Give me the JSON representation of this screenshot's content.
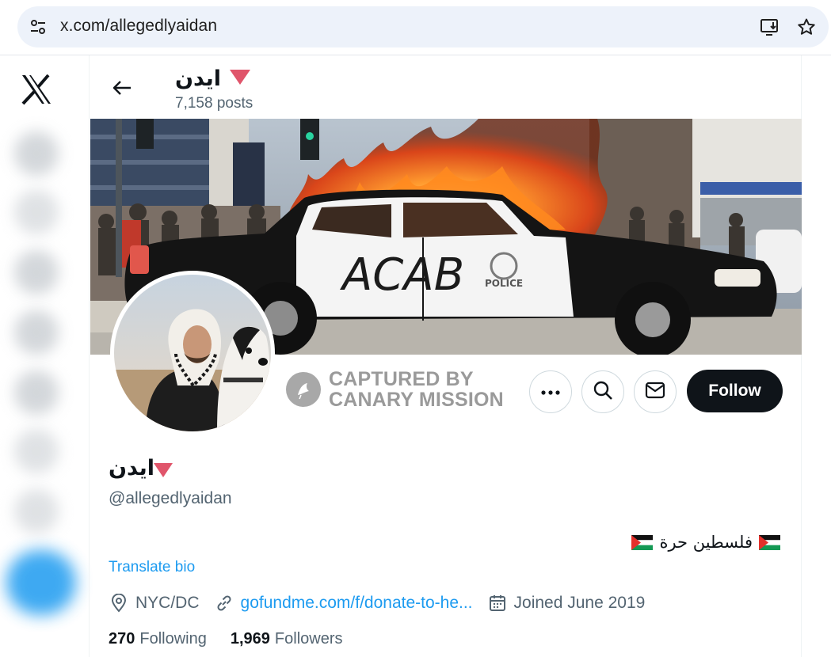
{
  "browser": {
    "url": "x.com/allegedlyaidan",
    "icons": [
      "site-info-icon",
      "install-app-icon",
      "bookmark-star-icon"
    ]
  },
  "nav": {
    "logo": "x-logo-icon"
  },
  "header": {
    "name": "ايدن",
    "posts_count": "7,158 posts"
  },
  "banner": {
    "car_graffiti": "ACAB",
    "car_badge": "POLICE"
  },
  "watermark": {
    "line1": "CAPTURED BY",
    "line2": "CANARY MISSION"
  },
  "actions": {
    "more_icon": "more-icon",
    "search_icon": "search-icon",
    "message_icon": "envelope-icon",
    "follow_label": "Follow"
  },
  "profile": {
    "display_name": "ايدن",
    "handle": "@allegedlyaidan",
    "bio": "فلسطين حرة",
    "translate_label": "Translate bio",
    "location": "NYC/DC",
    "website": "gofundme.com/f/donate-to-he...",
    "joined": "Joined June 2019",
    "following_count": "270",
    "following_label": "Following",
    "followers_count": "1,969",
    "followers_label": "Followers"
  },
  "colors": {
    "accent": "#1d9bf0",
    "text_primary": "#0f1419",
    "text_secondary": "#536471",
    "name_emoji": "#e0556b"
  }
}
